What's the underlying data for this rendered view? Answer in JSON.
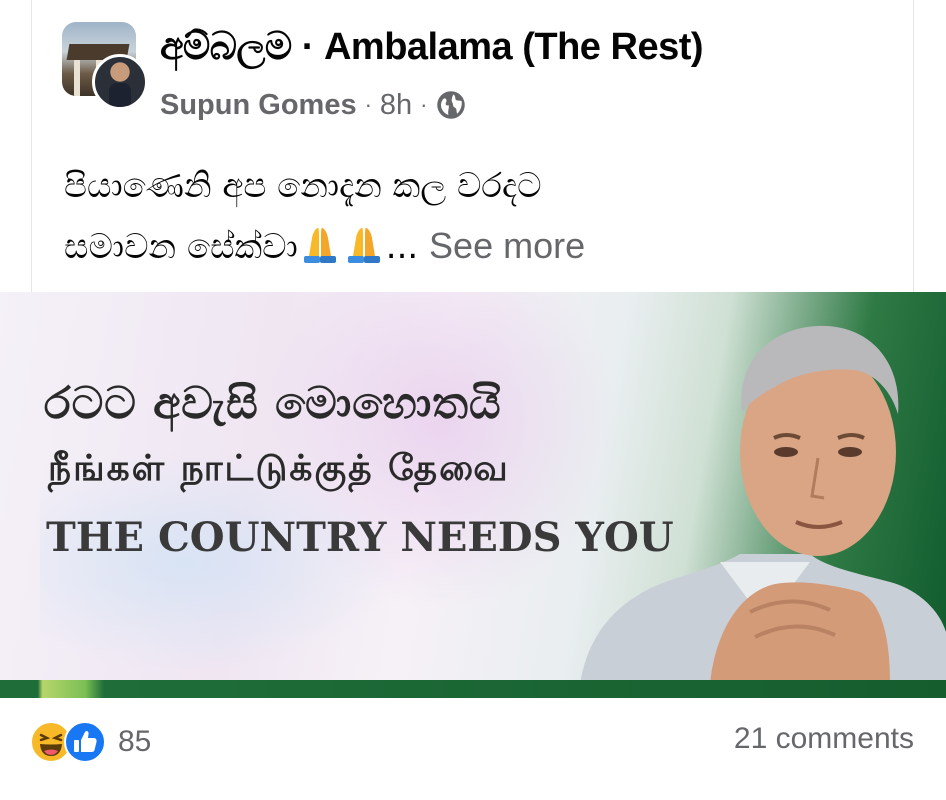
{
  "post": {
    "group_name": "අම්බලම · Ambalama (The Rest)",
    "author": "Supun Gomes",
    "time": "8h",
    "separator": "·",
    "privacy_icon": "globe-icon",
    "text_line1": "පියාණෙනි අප නොදැන කල වරදට",
    "text_line2": "සමාවන සේක්වා",
    "emoji": "folded-hands-icon",
    "ellipsis": "...",
    "see_more": "See more"
  },
  "image": {
    "line1": "රටට අවැසි මොහොතයි",
    "line2": "நீங்கள் நாட்டுக்குத் தேவை",
    "line3": "THE COUNTRY NEEDS YOU"
  },
  "footer": {
    "reaction_icons": [
      "haha-icon",
      "like-icon"
    ],
    "reaction_count": "85",
    "comments": "21 comments"
  },
  "colors": {
    "secondary_text": "#65676b",
    "like_blue": "#1877f2",
    "haha_yellow": "#f7b928",
    "banner_green": "#1f6e39"
  }
}
